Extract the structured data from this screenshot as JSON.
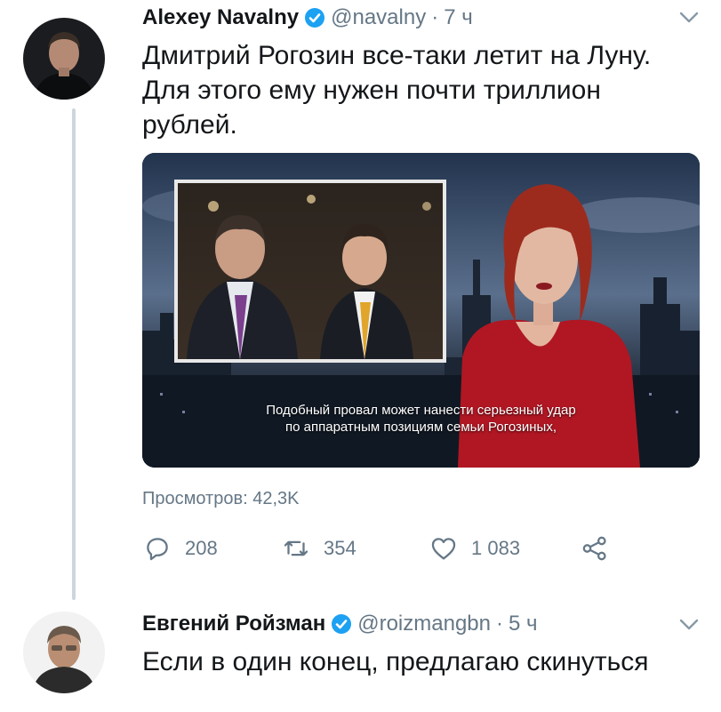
{
  "tweet1": {
    "display_name": "Alexey Navalny",
    "handle": "@navalny",
    "time_sep": "·",
    "time": "7 ч",
    "text_lines": [
      "Дмитрий Рогозин все-таки летит на Луну.",
      "Для этого ему нужен почти триллион",
      "рублей."
    ],
    "media": {
      "subtitle_line1": "Подобный провал может нанести серьезный удар",
      "subtitle_line2": "по аппаратным позициям семьи Рогозиных,"
    },
    "views": "Просмотров: 42,3K",
    "actions": {
      "replies": "208",
      "retweets": "354",
      "likes": "1 083"
    }
  },
  "tweet2": {
    "display_name": "Евгений Ройзман",
    "handle": "@roizmangbn",
    "time_sep": "·",
    "time": "5 ч",
    "text": "Если в один конец, предлагаю скинуться"
  },
  "icons": {
    "verified": "verified-badge-icon",
    "caret": "chevron-down-icon",
    "reply": "reply-icon",
    "retweet": "retweet-icon",
    "like": "heart-icon",
    "share": "share-icon"
  },
  "colors": {
    "text": "#14171a",
    "secondary": "#657786",
    "verified": "#1da1f2",
    "thread_line": "#ccd6dd"
  }
}
